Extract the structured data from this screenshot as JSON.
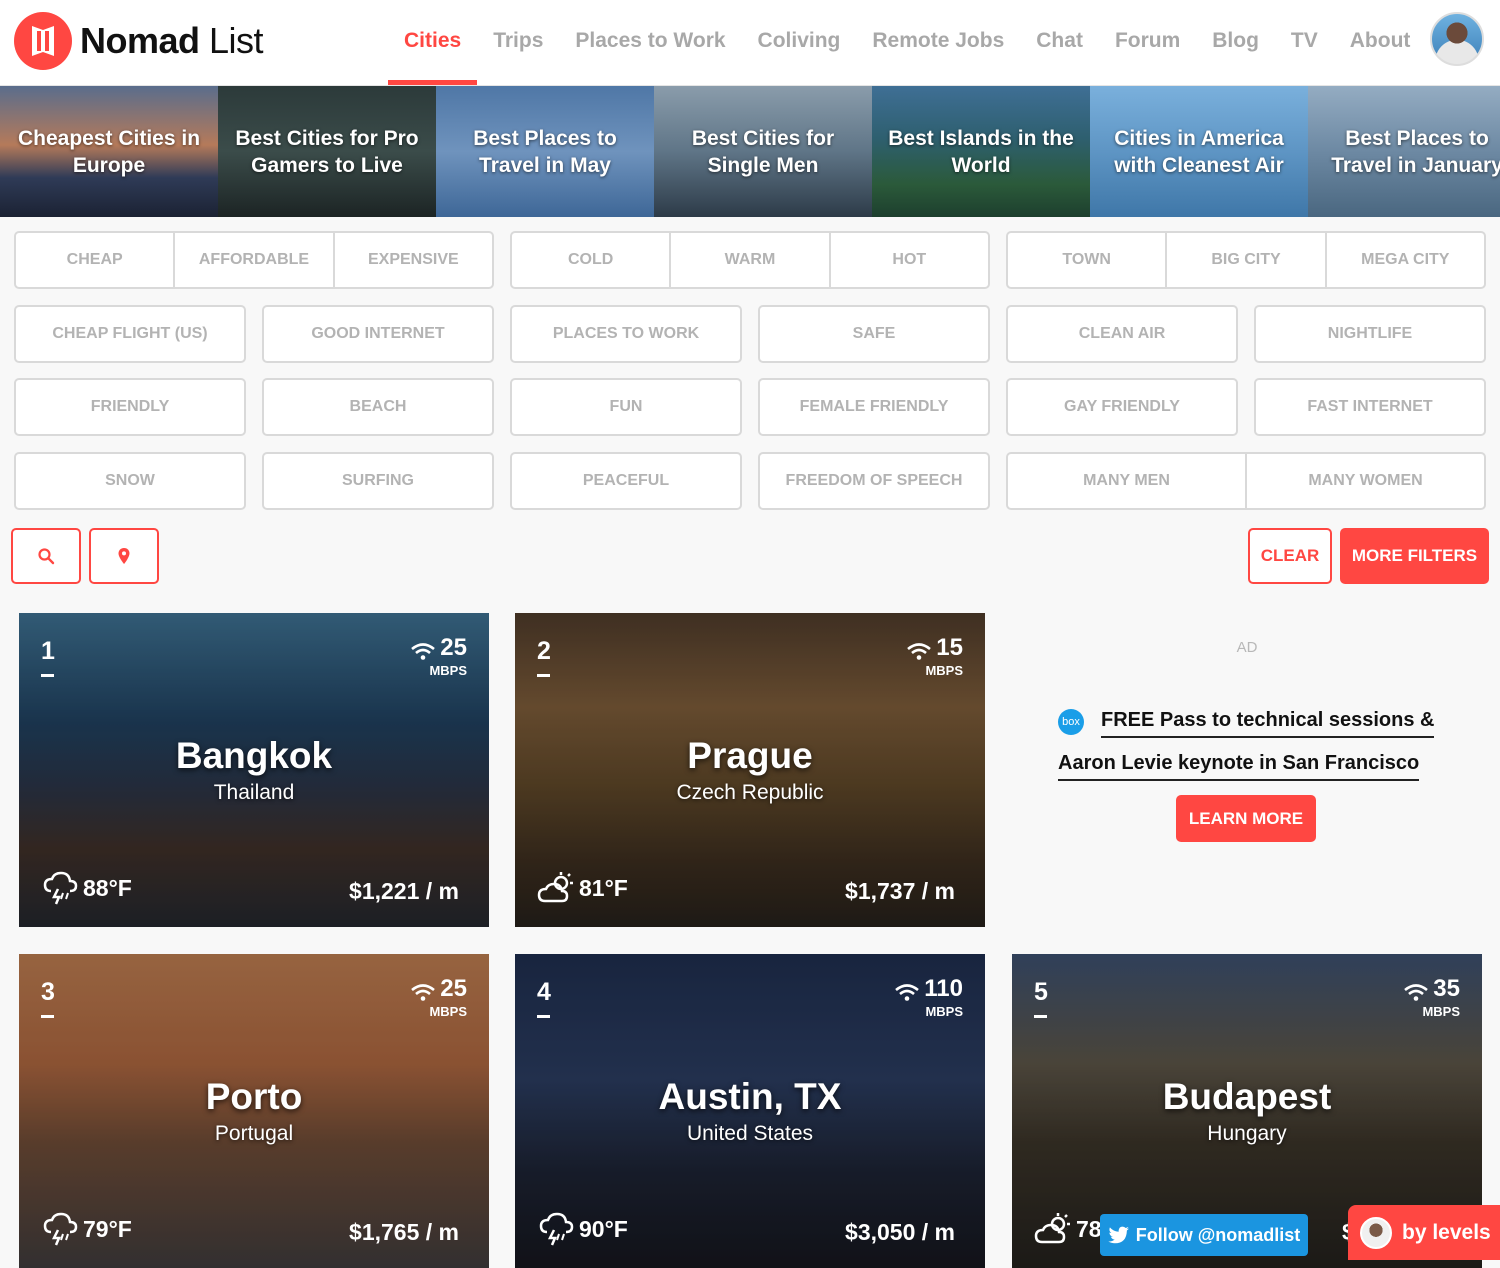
{
  "brand": {
    "name_bold": "Nomad",
    "name_light": "List",
    "color": "#ff4742"
  },
  "nav": {
    "items": [
      {
        "label": "Cities",
        "active": true
      },
      {
        "label": "Trips"
      },
      {
        "label": "Places to Work"
      },
      {
        "label": "Coliving"
      },
      {
        "label": "Remote Jobs"
      },
      {
        "label": "Chat"
      },
      {
        "label": "Forum"
      },
      {
        "label": "Blog"
      },
      {
        "label": "TV"
      },
      {
        "label": "About"
      }
    ]
  },
  "banners": [
    "Cheapest Cities in Europe",
    "Best Cities for Pro Gamers to Live",
    "Best Places to Travel in May",
    "Best Cities for Single Men",
    "Best Islands in the World",
    "Cities in America with Cleanest Air",
    "Best Places to Travel in January"
  ],
  "filters": {
    "row1": [
      [
        "CHEAP",
        "AFFORDABLE",
        "EXPENSIVE"
      ],
      [
        "COLD",
        "WARM",
        "HOT"
      ],
      [
        "TOWN",
        "BIG CITY",
        "MEGA CITY"
      ]
    ],
    "row2": [
      "CHEAP FLIGHT (US)",
      "GOOD INTERNET",
      "PLACES TO WORK",
      "SAFE",
      "CLEAN AIR",
      "NIGHTLIFE"
    ],
    "row3": [
      "FRIENDLY",
      "BEACH",
      "FUN",
      "FEMALE FRIENDLY",
      "GAY FRIENDLY",
      "FAST INTERNET"
    ],
    "row4": [
      "SNOW",
      "SURFING",
      "PEACEFUL",
      "FREEDOM OF SPEECH"
    ],
    "row4_group": [
      "MANY MEN",
      "MANY WOMEN"
    ]
  },
  "actions": {
    "search_icon": "search-icon",
    "location_icon": "location-pin-icon",
    "clear_label": "CLEAR",
    "more_filters_label": "MORE FILTERS"
  },
  "cities": [
    {
      "rank": "1",
      "name": "Bangkok",
      "country": "Thailand",
      "mbps": "25",
      "mbps_unit": "MBPS",
      "temp": "88°F",
      "weather_icon": "thunderstorm-icon",
      "cost": "$1,221 / m"
    },
    {
      "rank": "2",
      "name": "Prague",
      "country": "Czech Republic",
      "mbps": "15",
      "mbps_unit": "MBPS",
      "temp": "81°F",
      "weather_icon": "partly-cloudy-icon",
      "cost": "$1,737 / m"
    },
    {
      "rank": "3",
      "name": "Porto",
      "country": "Portugal",
      "mbps": "25",
      "mbps_unit": "MBPS",
      "temp": "79°F",
      "weather_icon": "thunderstorm-icon",
      "cost": "$1,765 / m"
    },
    {
      "rank": "4",
      "name": "Austin, TX",
      "country": "United States",
      "mbps": "110",
      "mbps_unit": "MBPS",
      "temp": "90°F",
      "weather_icon": "thunderstorm-icon",
      "cost": "$3,050 / m"
    },
    {
      "rank": "5",
      "name": "Budapest",
      "country": "Hungary",
      "mbps": "35",
      "mbps_unit": "MBPS",
      "temp": "78",
      "weather_icon": "partly-cloudy-icon",
      "cost": "$"
    }
  ],
  "ad": {
    "label": "AD",
    "logo": "box",
    "line1": "FREE Pass to technical sessions &",
    "line2": "Aaron Levie keynote in San Francisco",
    "button": "LEARN MORE"
  },
  "floating": {
    "follow_label": "Follow @nomadlist",
    "bylevels_label": "by levels"
  }
}
